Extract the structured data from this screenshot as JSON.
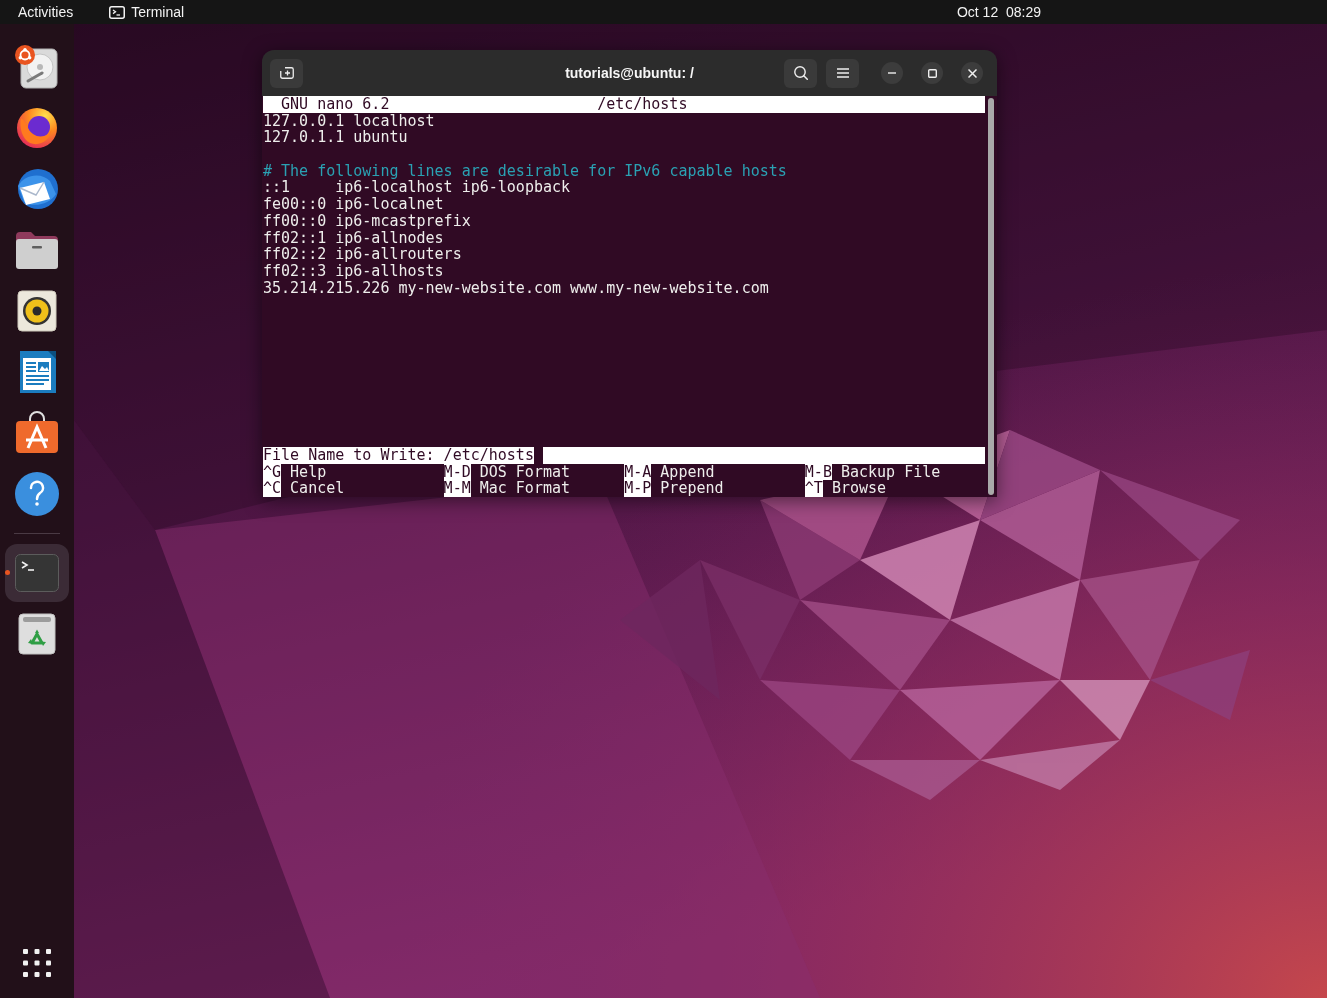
{
  "top_bar": {
    "activities": "Activities",
    "app_menu": "Terminal",
    "clock": "Oct 12  08:29"
  },
  "dock": {
    "pinned": [
      {
        "kind": "installer",
        "selected": false,
        "running": false
      },
      {
        "kind": "browser",
        "selected": false,
        "running": false
      },
      {
        "kind": "mail",
        "selected": false,
        "running": false
      },
      {
        "kind": "files",
        "selected": false,
        "running": false
      },
      {
        "kind": "music",
        "selected": false,
        "running": false
      },
      {
        "kind": "writer",
        "selected": false,
        "running": false
      },
      {
        "kind": "store",
        "selected": false,
        "running": false
      },
      {
        "kind": "help",
        "selected": false,
        "running": false
      }
    ],
    "others": [
      {
        "kind": "terminal",
        "selected": true,
        "running": true
      },
      {
        "kind": "trash",
        "selected": false,
        "running": false
      }
    ]
  },
  "window": {
    "title": "tutorials@ubuntu: /"
  },
  "nano": {
    "version": "GNU nano 6.2",
    "filename": "/etc/hosts",
    "lines": [
      {
        "kind": "entry",
        "text": "127.0.0.1 localhost"
      },
      {
        "kind": "entry",
        "text": "127.0.1.1 ubuntu"
      },
      {
        "kind": "blank"
      },
      {
        "kind": "comment",
        "text": "# The following lines are desirable for IPv6 capable hosts"
      },
      {
        "kind": "entry",
        "text": "::1     ip6-localhost ip6-loopback"
      },
      {
        "kind": "entry",
        "text": "fe00::0 ip6-localnet"
      },
      {
        "kind": "entry",
        "text": "ff00::0 ip6-mcastprefix"
      },
      {
        "kind": "entry",
        "text": "ff02::1 ip6-allnodes"
      },
      {
        "kind": "entry",
        "text": "ff02::2 ip6-allrouters"
      },
      {
        "kind": "entry",
        "text": "ff02::3 ip6-allhosts"
      },
      {
        "kind": "entry",
        "text": "35.214.215.226 my-new-website.com www.my-new-website.com"
      }
    ],
    "prompt": {
      "label": "File Name to Write:",
      "value": "/etc/hosts"
    },
    "shortcuts": [
      {
        "key": "^G",
        "label": "Help"
      },
      {
        "key": "M-D",
        "label": "DOS Format"
      },
      {
        "key": "M-A",
        "label": "Append"
      },
      {
        "key": "M-B",
        "label": "Backup File"
      },
      {
        "key": "^C",
        "label": "Cancel"
      },
      {
        "key": "M-M",
        "label": "Mac Format"
      },
      {
        "key": "M-P",
        "label": "Prepend"
      },
      {
        "key": "^T",
        "label": "Browse"
      }
    ]
  }
}
